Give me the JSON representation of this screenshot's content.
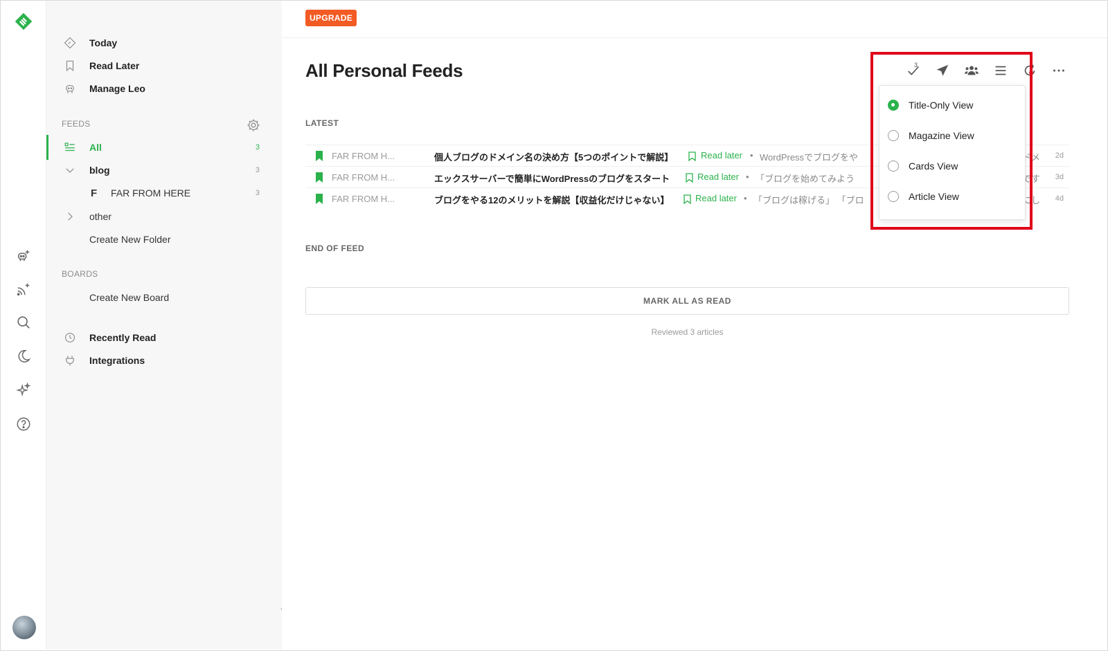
{
  "rail": {
    "logo": "feedly-logo-icon",
    "items": [
      "add-source-icon",
      "add-feed-icon",
      "search-icon",
      "night-mode-icon",
      "ai-sparkle-icon",
      "help-icon"
    ]
  },
  "sidebar": {
    "top_items": [
      {
        "label": "Today",
        "icon": "today-icon"
      },
      {
        "label": "Read Later",
        "icon": "bookmark-icon"
      },
      {
        "label": "Manage Leo",
        "icon": "leo-icon"
      }
    ],
    "feeds_heading": "FEEDS",
    "feeds": {
      "all_label": "All",
      "all_count": "3",
      "blog_label": "blog",
      "blog_count": "3",
      "feed_letter": "F",
      "feed_name": "FAR FROM HERE",
      "feed_count": "3",
      "other_label": "other",
      "create_folder": "Create New Folder"
    },
    "boards_heading": "BOARDS",
    "create_board": "Create New Board",
    "bottom_items": [
      {
        "label": "Recently Read",
        "icon": "clock-icon"
      },
      {
        "label": "Integrations",
        "icon": "plug-icon"
      }
    ]
  },
  "main": {
    "upgrade_label": "UPGRADE",
    "title": "All Personal Feeds",
    "mark_count": "3",
    "latest_heading": "LATEST",
    "entries": [
      {
        "source": "FAR FROM H...",
        "title": "個人ブログのドメイン名の決め方【5つのポイントで解説】",
        "read_later": "Read later",
        "snippet": "WordPressでブログをや",
        "snippet_tail": "カドメ",
        "age": "2d"
      },
      {
        "source": "FAR FROM H...",
        "title": "エックスサーバーで簡単にWordPressのブログをスタート",
        "read_later": "Read later",
        "snippet": "「ブログを始めてみよう",
        "snippet_tail": "みです",
        "age": "3d"
      },
      {
        "source": "FAR FROM H...",
        "title": "ブログをやる12のメリットを解説【収益化だけじゃない】",
        "read_later": "Read later",
        "snippet": "「ブログは稼げる」 「ブロ",
        "snippet_tail": "耳にし",
        "age": "4d"
      }
    ],
    "end_heading": "END OF FEED",
    "mark_all_label": "MARK ALL AS READ",
    "reviewed_text": "Reviewed 3 articles"
  },
  "view_menu": {
    "options": [
      {
        "label": "Title-Only View",
        "selected": true
      },
      {
        "label": "Magazine View",
        "selected": false
      },
      {
        "label": "Cards View",
        "selected": false
      },
      {
        "label": "Article View",
        "selected": false
      }
    ]
  },
  "colors": {
    "accent_green": "#2bb24c",
    "upgrade_orange": "#f35b24",
    "highlight_red": "#e00019"
  }
}
